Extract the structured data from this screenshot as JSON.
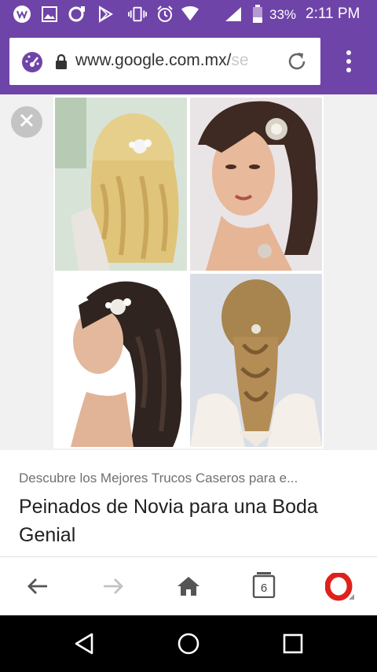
{
  "status_bar": {
    "battery_percent": "33%",
    "time": "2:11 PM",
    "icons": [
      "vpn-icon",
      "image-icon",
      "update-icon",
      "play-store-icon",
      "vibrate-icon",
      "alarm-icon",
      "wifi-icon",
      "signal-icon",
      "battery-icon"
    ]
  },
  "toolbar": {
    "url_main": "www.google.com.mx/",
    "url_faded": "se",
    "icons": [
      "speed-dial-icon",
      "lock-icon",
      "reload-icon",
      "menu-icon"
    ]
  },
  "content": {
    "close_icon": "close-icon",
    "collage_photos": [
      "bride-back-blonde-curls",
      "bride-portrait-brunette-hairpin",
      "bride-side-dark-curls",
      "bride-back-braided-ponytail"
    ]
  },
  "result": {
    "source": "Descubre los Mejores Trucos Caseros para e...",
    "title": "Peinados de Novia para una Boda Genial"
  },
  "browser_nav": {
    "tab_count": "6",
    "icons": [
      "back-arrow-icon",
      "forward-arrow-icon",
      "home-icon",
      "tabs-icon",
      "opera-logo-icon"
    ]
  },
  "android_nav": {
    "icons": [
      "back-triangle-icon",
      "home-circle-icon",
      "recents-square-icon"
    ]
  },
  "colors": {
    "brand_purple": "#6f44a8",
    "opera_red": "#e0201b",
    "content_bg": "#f1f1f1"
  }
}
